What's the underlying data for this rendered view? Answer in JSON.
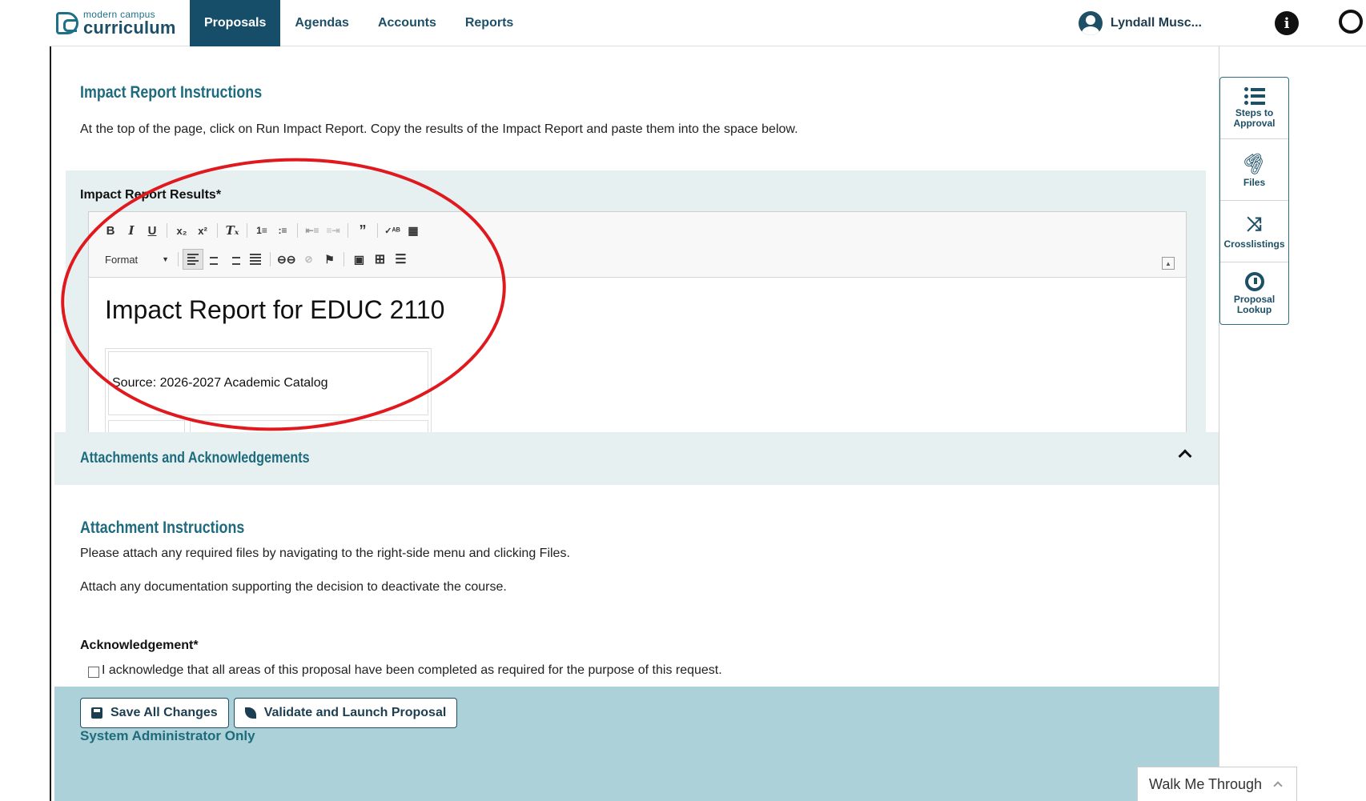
{
  "app": {
    "logo_top": "modern campus",
    "logo_bottom": "curriculum",
    "nav": [
      {
        "label": "Proposals",
        "active": true
      },
      {
        "label": "Agendas",
        "active": false
      },
      {
        "label": "Accounts",
        "active": false
      },
      {
        "label": "Reports",
        "active": false
      }
    ],
    "user_name": "Lyndall Musc..."
  },
  "impact": {
    "title": "Impact Report Instructions",
    "instructions": "At the top of the page, click on Run Impact Report. Copy the results of the Impact Report and paste them into the space below.",
    "results_label": "Impact Report Results*",
    "editor": {
      "format_label": "Format",
      "heading": "Impact Report for EDUC 2110",
      "source": "Source: 2026-2027 Academic Catalog"
    }
  },
  "attachments": {
    "section_title": "Attachments and Acknowledgements",
    "instr_title": "Attachment Instructions",
    "line1": "Please attach any required files by navigating to the right-side menu and clicking Files.",
    "line2": "Attach any documentation supporting the decision to deactivate the course.",
    "ack_label": "Acknowledgement*",
    "ack_text": "I acknowledge that all areas of this proposal have been completed as required for the purpose of this request.",
    "ack_checked": false
  },
  "footer": {
    "save_label": "Save All Changes",
    "validate_label": "Validate and Launch Proposal",
    "sysadmin": "System Administrator Only"
  },
  "side_panel": [
    {
      "label": "Steps to Approval",
      "icon": "list-icon"
    },
    {
      "label": "Files",
      "icon": "paperclip-icon"
    },
    {
      "label": "Crosslistings",
      "icon": "shuffle-icon"
    },
    {
      "label": "Proposal Lookup",
      "icon": "history-icon"
    }
  ],
  "walk_me": "Walk Me Through",
  "colors": {
    "brand": "#164e69",
    "teal_heading": "#1d6b7d",
    "panel_bg": "#e6f0f1",
    "footer_bg": "#add1d8",
    "annotation_circle": "#e0191f"
  }
}
